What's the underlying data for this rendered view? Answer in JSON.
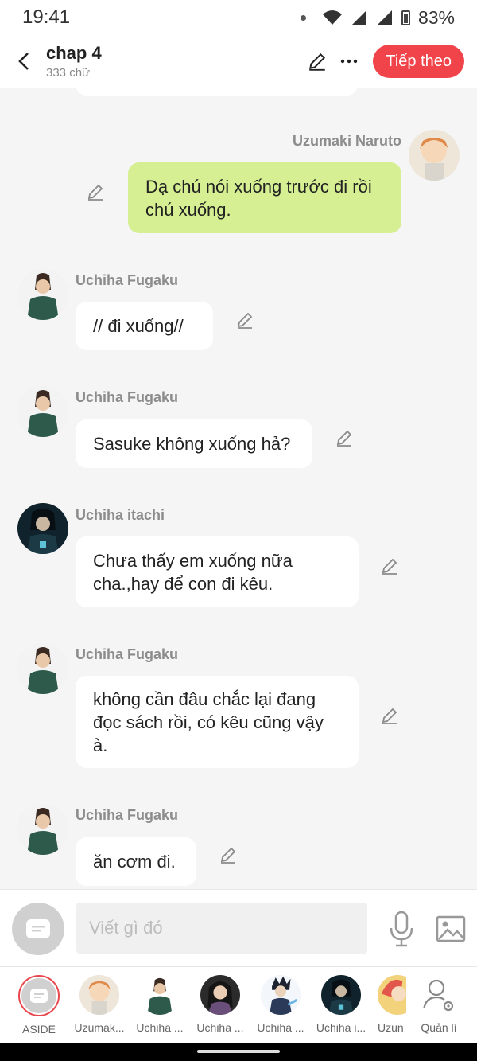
{
  "status": {
    "time": "19:41",
    "battery": "83%"
  },
  "header": {
    "title": "chap 4",
    "subtitle": "333 chữ",
    "next_label": "Tiếp theo"
  },
  "messages": [
    {
      "name": "Uzumaki Naruto",
      "text": "Dạ chú nói xuống trước đi rồi chú xuống.",
      "line1": "Dạ chú nói xuống trước đi rồi",
      "line2": "chú xuống.",
      "mine": true,
      "avatar": "naruto-avatar"
    },
    {
      "name": "Uchiha Fugaku",
      "text": "// đi xuống//",
      "avatar": "fugaku-avatar"
    },
    {
      "name": "Uchiha Fugaku",
      "text": "Sasuke không xuống hả?",
      "avatar": "fugaku-avatar"
    },
    {
      "name": "Uchiha itachi",
      "line1": "Chưa thấy em xuống nữa",
      "line2": "cha.,hay để con đi kêu.",
      "avatar": "itachi-avatar"
    },
    {
      "name": "Uchiha Fugaku",
      "line1": "không cần đâu chắc lại đang",
      "line2": "đọc sách rồi, có kêu cũng vậy",
      "line3": "à.",
      "avatar": "fugaku-avatar"
    },
    {
      "name": "Uchiha Fugaku",
      "text": "ăn cơm đi.",
      "avatar": "fugaku-avatar"
    }
  ],
  "composer": {
    "placeholder": "Viết gì đó"
  },
  "characters": [
    {
      "label": "ASIDE"
    },
    {
      "label": "Uzumak..."
    },
    {
      "label": "Uchiha ..."
    },
    {
      "label": "Uchiha ..."
    },
    {
      "label": "Uchiha ..."
    },
    {
      "label": "Uchiha i..."
    },
    {
      "label": "Uzun"
    },
    {
      "label": "Quản lí"
    }
  ],
  "colors": {
    "accent": "#f0434a",
    "mine_bubble": "#d6ef92",
    "background": "#f5f5f5"
  }
}
